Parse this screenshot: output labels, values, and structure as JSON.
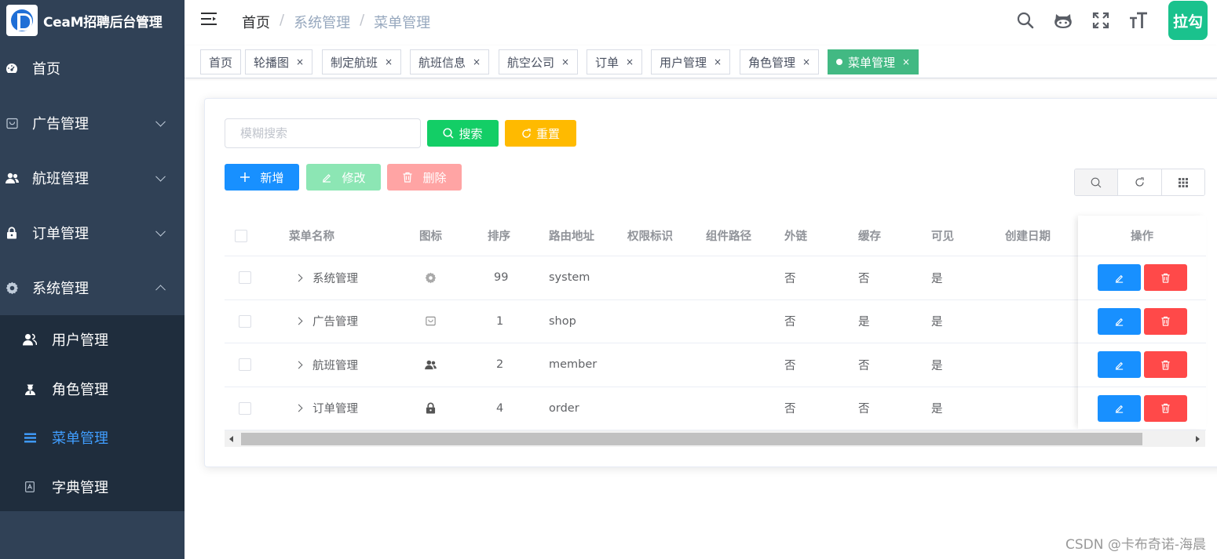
{
  "app": {
    "title": "CeaM招聘后台管理"
  },
  "sidebar": {
    "items": [
      {
        "label": "首页",
        "icon": "dashboard-icon"
      },
      {
        "label": "广告管理",
        "icon": "shopping-icon"
      },
      {
        "label": "航班管理",
        "icon": "peoples-icon"
      },
      {
        "label": "订单管理",
        "icon": "lock-icon"
      },
      {
        "label": "系统管理",
        "icon": "system-icon"
      }
    ],
    "submenu": [
      {
        "label": "用户管理",
        "icon": "user-icon"
      },
      {
        "label": "角色管理",
        "icon": "role-icon"
      },
      {
        "label": "菜单管理",
        "icon": "menu-icon",
        "active": true
      },
      {
        "label": "字典管理",
        "icon": "dict-icon"
      }
    ]
  },
  "navbar": {
    "breadcrumb": [
      "首页",
      "系统管理",
      "菜单管理"
    ],
    "avatar_text": "拉勾",
    "avatar_color": "#1ac28d"
  },
  "tags": [
    {
      "label": "首页"
    },
    {
      "label": "轮播图",
      "close": "×"
    },
    {
      "label": "制定航班",
      "close": "×"
    },
    {
      "label": "航班信息",
      "close": "×"
    },
    {
      "label": "航空公司",
      "close": "×"
    },
    {
      "label": "订单",
      "close": "×"
    },
    {
      "label": "用户管理",
      "close": "×"
    },
    {
      "label": "角色管理",
      "close": "×"
    },
    {
      "label": "菜单管理",
      "close": "×",
      "active": true
    }
  ],
  "toolbar": {
    "search_placeholder": "模糊搜索",
    "search_label": "搜索",
    "reset_label": "重置",
    "add_label": "新增",
    "edit_label": "修改",
    "delete_label": "删除"
  },
  "table": {
    "columns": [
      "菜单名称",
      "图标",
      "排序",
      "路由地址",
      "权限标识",
      "组件路径",
      "外链",
      "缓存",
      "可见",
      "创建日期",
      "操作"
    ],
    "rows": [
      {
        "name": "系统管理",
        "icon": "system-icon",
        "sort": "99",
        "path": "system",
        "perm": "",
        "component": "",
        "iframe": "否",
        "cache": "否",
        "hidden": "是",
        "date": ""
      },
      {
        "name": "广告管理",
        "icon": "shopping-icon",
        "sort": "1",
        "path": "shop",
        "perm": "",
        "component": "",
        "iframe": "否",
        "cache": "是",
        "hidden": "是",
        "date": ""
      },
      {
        "name": "航班管理",
        "icon": "peoples-icon",
        "sort": "2",
        "path": "member",
        "perm": "",
        "component": "",
        "iframe": "否",
        "cache": "否",
        "hidden": "是",
        "date": ""
      },
      {
        "name": "订单管理",
        "icon": "lock-icon",
        "sort": "4",
        "path": "order",
        "perm": "",
        "component": "",
        "iframe": "否",
        "cache": "否",
        "hidden": "是",
        "date": ""
      }
    ]
  },
  "colors": {
    "sidebar_bg": "#304156",
    "active_menu": "#409eff",
    "tag_active": "#42b983",
    "primary": "#1890ff",
    "success": "#13ce66",
    "warning": "#ffba00",
    "danger": "#ff4949"
  },
  "watermark": "CSDN @卡布奇诺-海晨"
}
